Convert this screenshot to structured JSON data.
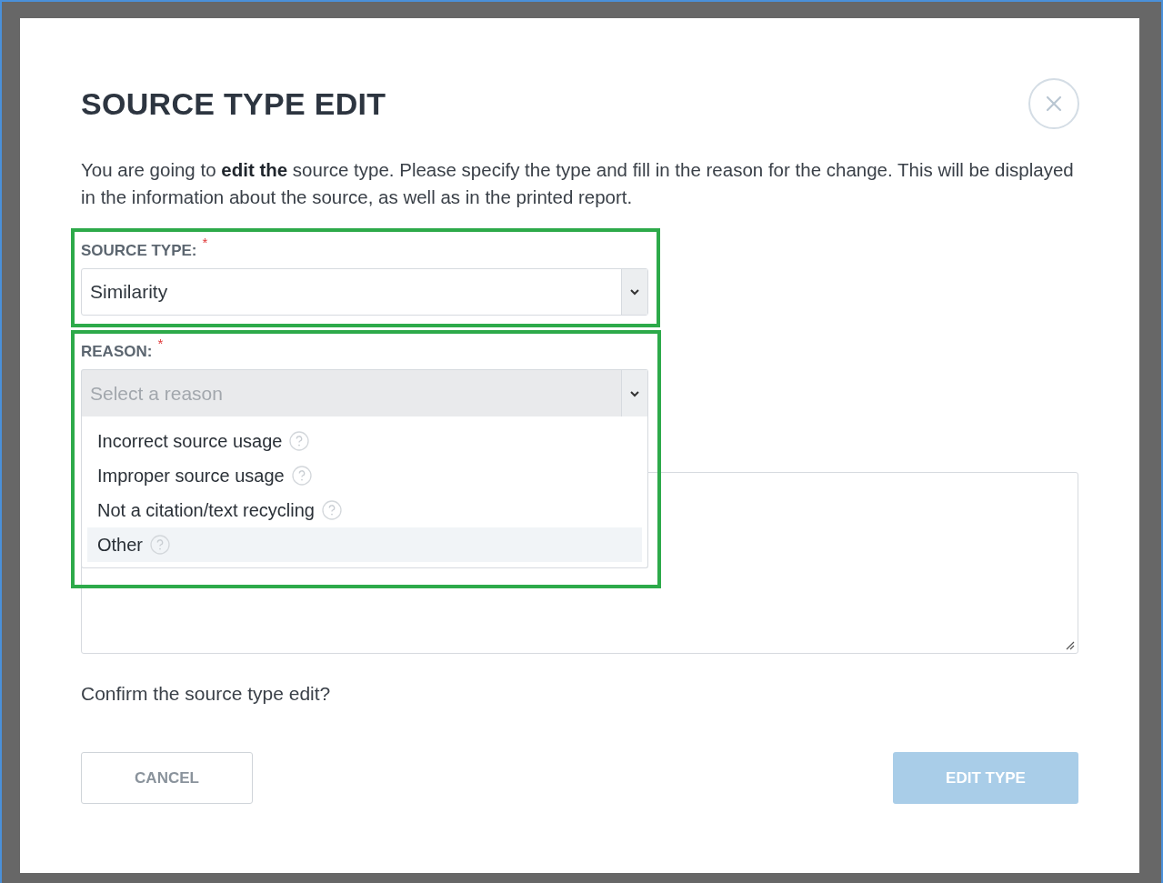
{
  "dialog": {
    "title": "SOURCE TYPE EDIT",
    "description": "You are going to **edit the** source type. Please specify the type and fill in the reason for the change. This will be displayed in the information about the source, as well as in the printed report."
  },
  "source_type": {
    "label": "SOURCE TYPE:",
    "required_mark": "*",
    "value": "Similarity",
    "highlighted": true
  },
  "reason": {
    "label": "REASON:",
    "required_mark": "*",
    "placeholder": "Select a reason",
    "expanded": true,
    "highlighted": true,
    "options": [
      {
        "label": "Incorrect source usage",
        "selected": false
      },
      {
        "label": "Improper source usage",
        "selected": false
      },
      {
        "label": "Not a citation/text recycling",
        "selected": false
      },
      {
        "label": "Other",
        "selected": true
      }
    ]
  },
  "confirm_text": "Confirm the source type edit?",
  "buttons": [
    {
      "label": "CANCEL",
      "kind": "secondary",
      "disabled": false
    },
    {
      "label": "EDIT TYPE",
      "kind": "primary",
      "disabled": true
    }
  ]
}
